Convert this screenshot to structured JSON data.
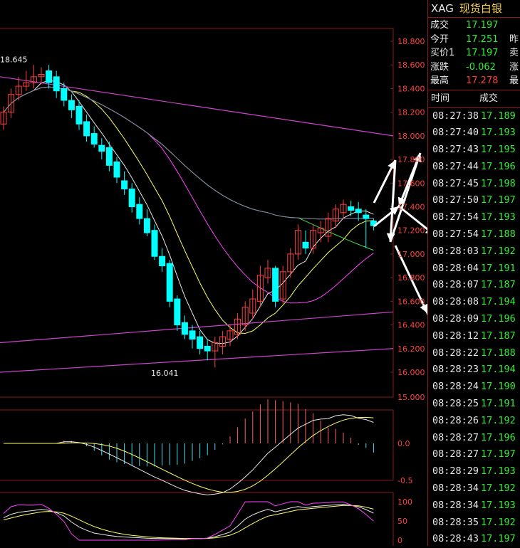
{
  "symbol": "XAG",
  "name": "现货白银",
  "quote": [
    {
      "label": "成交",
      "value": "17.197",
      "color": "green",
      "extra": ""
    },
    {
      "label": "今开",
      "value": "17.251",
      "color": "green",
      "extra": "昨"
    },
    {
      "label": "买价1",
      "value": "17.197",
      "color": "green",
      "extra": "卖"
    },
    {
      "label": "涨跌",
      "value": "-0.062",
      "color": "green",
      "extra": "涨"
    },
    {
      "label": "最高",
      "value": "17.278",
      "color": "red",
      "extra": "最"
    }
  ],
  "ticks_header": {
    "time": "时间",
    "price": "成交"
  },
  "ticks": [
    {
      "time": "08:27:38",
      "price": "17.189"
    },
    {
      "time": "08:27:40",
      "price": "17.193"
    },
    {
      "time": "08:27:43",
      "price": "17.195"
    },
    {
      "time": "08:27:44",
      "price": "17.196"
    },
    {
      "time": "08:27:45",
      "price": "17.198"
    },
    {
      "time": "08:27:50",
      "price": "17.197"
    },
    {
      "time": "08:27:54",
      "price": "17.193"
    },
    {
      "time": "08:27:54",
      "price": "17.188"
    },
    {
      "time": "08:28:03",
      "price": "17.192"
    },
    {
      "time": "08:28:04",
      "price": "17.191"
    },
    {
      "time": "08:28:07",
      "price": "17.187"
    },
    {
      "time": "08:28:08",
      "price": "17.194"
    },
    {
      "time": "08:28:09",
      "price": "17.196"
    },
    {
      "time": "08:28:12",
      "price": "17.187"
    },
    {
      "time": "08:28:22",
      "price": "17.188"
    },
    {
      "time": "08:28:23",
      "price": "17.194"
    },
    {
      "time": "08:28:24",
      "price": "17.190"
    },
    {
      "time": "08:28:25",
      "price": "17.191"
    },
    {
      "time": "08:28:26",
      "price": "17.192"
    },
    {
      "time": "08:28:27",
      "price": "17.196"
    },
    {
      "time": "08:28:27",
      "price": "17.197"
    },
    {
      "time": "08:28:29",
      "price": "17.193"
    },
    {
      "time": "08:28:34",
      "price": "17.192"
    },
    {
      "time": "08:28:34",
      "price": "17.193"
    },
    {
      "time": "08:28:35",
      "price": "17.192"
    },
    {
      "time": "08:28:43",
      "price": "17.197"
    }
  ],
  "chart_data": [
    {
      "type": "candlestick",
      "ylim": [
        16.0,
        18.8
      ],
      "y_ticks": [
        "18.800",
        "18.600",
        "18.400",
        "18.200",
        "18.000",
        "17.800",
        "17.600",
        "17.400",
        "17.200",
        "17.000",
        "16.800",
        "16.600",
        "16.400",
        "16.200",
        "16.000"
      ],
      "y_tick_values": [
        18.8,
        18.6,
        18.4,
        18.2,
        18.0,
        17.8,
        17.6,
        17.4,
        17.2,
        17.0,
        16.8,
        16.6,
        16.4,
        16.2,
        16.0
      ],
      "y_floor_label": "15.000",
      "annotations": [
        {
          "text": "18.645",
          "value": 18.645
        },
        {
          "text": "16.041",
          "value": 16.041
        }
      ],
      "colors": {
        "up": "#ff4040",
        "down": "#00ffff"
      },
      "candles": [
        [
          18.1,
          18.2,
          18.05,
          18.25
        ],
        [
          18.2,
          18.35,
          18.15,
          18.4
        ],
        [
          18.35,
          18.42,
          18.3,
          18.5
        ],
        [
          18.42,
          18.45,
          18.38,
          18.55
        ],
        [
          18.45,
          18.5,
          18.4,
          18.6
        ],
        [
          18.5,
          18.52,
          18.44,
          18.58
        ],
        [
          18.55,
          18.45,
          18.4,
          18.6
        ],
        [
          18.5,
          18.38,
          18.32,
          18.55
        ],
        [
          18.4,
          18.3,
          18.25,
          18.45
        ],
        [
          18.3,
          18.22,
          18.15,
          18.35
        ],
        [
          18.25,
          18.1,
          18.05,
          18.3
        ],
        [
          18.12,
          18.0,
          17.95,
          18.18
        ],
        [
          18.02,
          17.93,
          17.9,
          18.08
        ],
        [
          17.92,
          17.87,
          17.8,
          17.98
        ],
        [
          17.9,
          17.75,
          17.7,
          17.95
        ],
        [
          17.78,
          17.65,
          17.6,
          17.82
        ],
        [
          17.62,
          17.55,
          17.5,
          17.7
        ],
        [
          17.55,
          17.4,
          17.35,
          17.6
        ],
        [
          17.42,
          17.3,
          17.25,
          17.48
        ],
        [
          17.3,
          17.18,
          17.15,
          17.38
        ],
        [
          17.2,
          16.98,
          16.95,
          17.25
        ],
        [
          16.98,
          16.9,
          16.85,
          17.05
        ],
        [
          16.92,
          16.6,
          16.55,
          16.95
        ],
        [
          16.62,
          16.4,
          16.35,
          16.65
        ],
        [
          16.42,
          16.32,
          16.28,
          16.48
        ],
        [
          16.35,
          16.28,
          16.2,
          16.4
        ],
        [
          16.3,
          16.2,
          16.15,
          16.35
        ],
        [
          16.22,
          16.18,
          16.1,
          16.28
        ],
        [
          16.18,
          16.25,
          16.04,
          16.3
        ],
        [
          16.22,
          16.3,
          16.15,
          16.35
        ],
        [
          16.28,
          16.35,
          16.22,
          16.4
        ],
        [
          16.32,
          16.45,
          16.28,
          16.5
        ],
        [
          16.4,
          16.55,
          16.35,
          16.6
        ],
        [
          16.5,
          16.62,
          16.45,
          16.7
        ],
        [
          16.6,
          16.82,
          16.55,
          16.9
        ],
        [
          16.8,
          16.88,
          16.75,
          16.95
        ],
        [
          16.88,
          16.6,
          16.55,
          16.9
        ],
        [
          16.62,
          16.85,
          16.58,
          16.9
        ],
        [
          16.85,
          17.0,
          16.8,
          17.05
        ],
        [
          17.0,
          17.2,
          16.95,
          17.25
        ],
        [
          17.1,
          17.05,
          17.0,
          17.2
        ],
        [
          17.05,
          17.2,
          17.0,
          17.25
        ],
        [
          17.18,
          17.22,
          17.1,
          17.28
        ],
        [
          17.15,
          17.3,
          17.1,
          17.35
        ],
        [
          17.28,
          17.38,
          17.22,
          17.42
        ],
        [
          17.35,
          17.42,
          17.3,
          17.46
        ],
        [
          17.4,
          17.37,
          17.32,
          17.45
        ],
        [
          17.38,
          17.35,
          17.28,
          17.44
        ],
        [
          17.33,
          17.3,
          17.05,
          17.38
        ],
        [
          17.28,
          17.24,
          17.2,
          17.3
        ]
      ]
    },
    {
      "type": "bar",
      "ylim": [
        -0.5,
        0.5
      ],
      "y_ticks": [
        "0.0",
        "-0.5"
      ],
      "y_tick_values": [
        0.0,
        -0.5
      ]
    },
    {
      "type": "line",
      "ylim": [
        0,
        100
      ],
      "y_ticks": [
        "100",
        "50",
        "0"
      ],
      "y_tick_values": [
        100,
        50,
        0
      ]
    }
  ]
}
